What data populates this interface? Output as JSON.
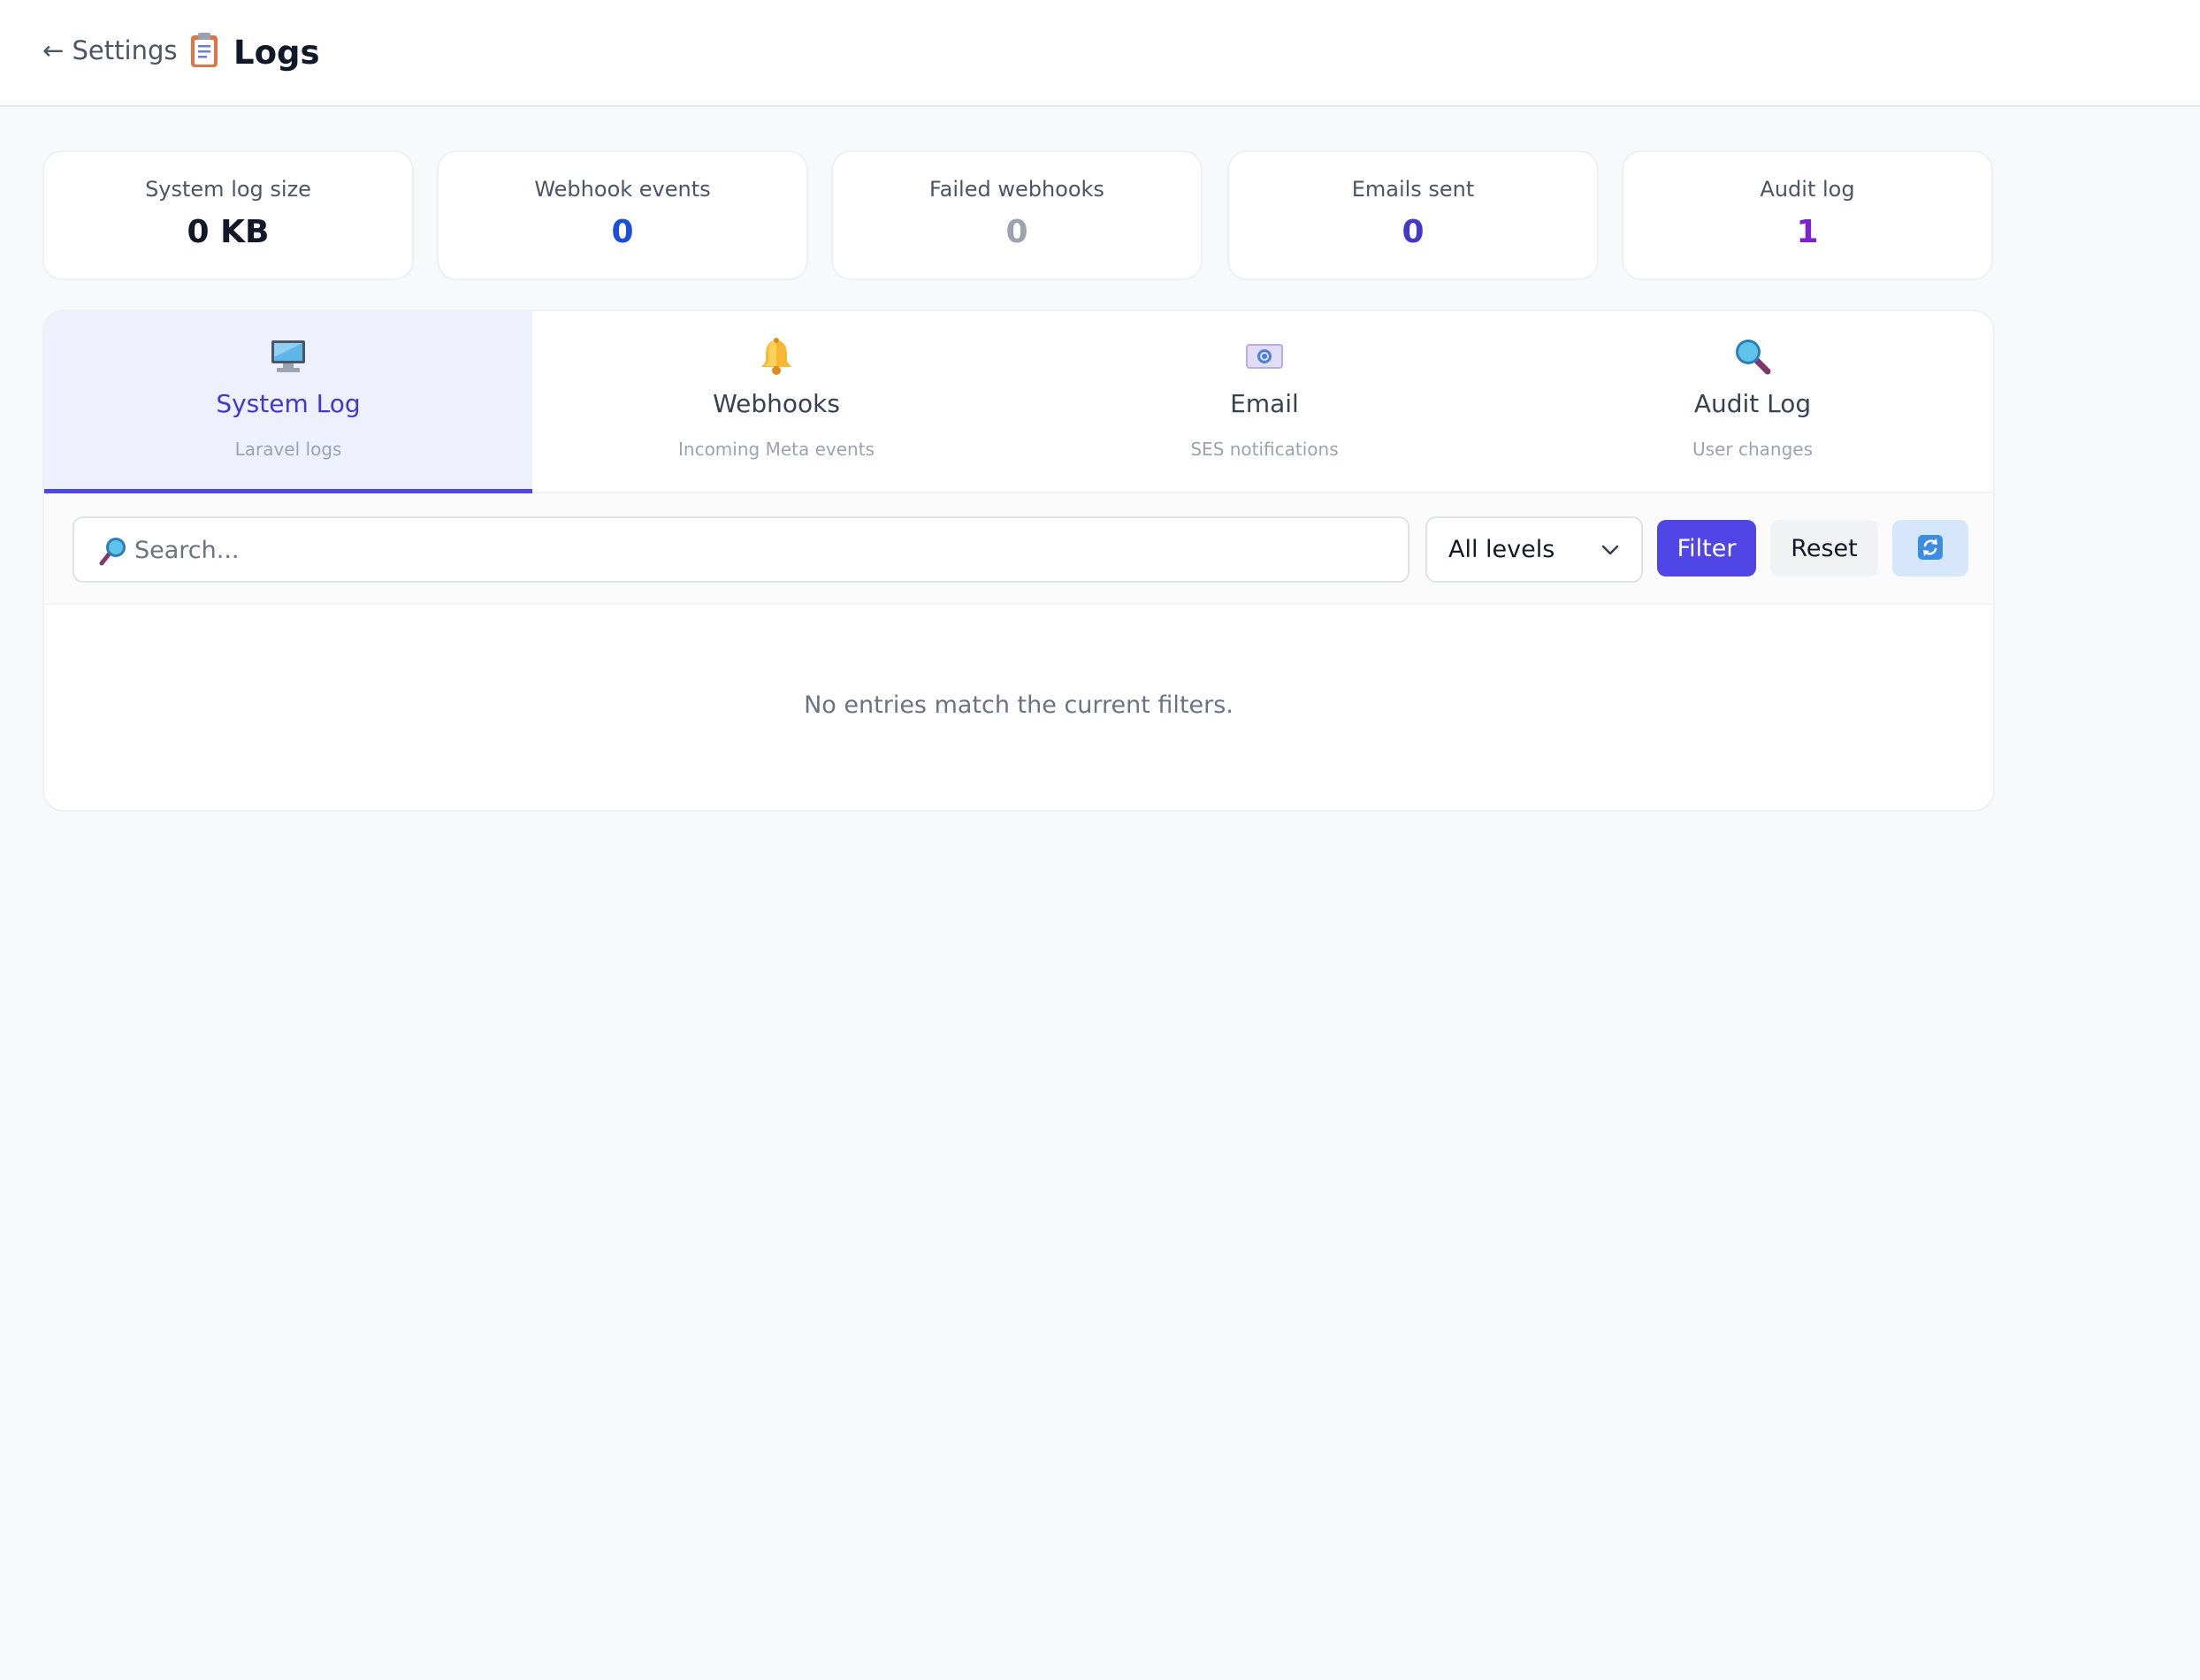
{
  "header": {
    "back_label": "← Settings",
    "title": "Logs",
    "title_icon": "clipboard-icon"
  },
  "stats": [
    {
      "label": "System log size",
      "value": "0 KB",
      "color": "#111827"
    },
    {
      "label": "Webhook events",
      "value": "0",
      "color": "#1d4ed8"
    },
    {
      "label": "Failed webhooks",
      "value": "0",
      "color": "#9ca3af"
    },
    {
      "label": "Emails sent",
      "value": "0",
      "color": "#4338ca"
    },
    {
      "label": "Audit log",
      "value": "1",
      "color": "#7e22ce"
    }
  ],
  "tabs": [
    {
      "label": "System Log",
      "sub": "Laravel logs",
      "icon": "monitor-icon",
      "active": true
    },
    {
      "label": "Webhooks",
      "sub": "Incoming Meta events",
      "icon": "bell-icon",
      "active": false
    },
    {
      "label": "Email",
      "sub": "SES notifications",
      "icon": "email-icon",
      "active": false
    },
    {
      "label": "Audit Log",
      "sub": "User changes",
      "icon": "magnifier-icon",
      "active": false
    }
  ],
  "filters": {
    "search_placeholder": "Search...",
    "search_value": "",
    "level_selected": "All levels",
    "filter_label": "Filter",
    "reset_label": "Reset",
    "refresh_icon": "refresh-icon"
  },
  "empty_message": "No entries match the current filters.",
  "colors": {
    "accent": "#4f46e5",
    "active_tab_bg": "#eef0fe",
    "refresh_bg": "#d6e6fb"
  }
}
